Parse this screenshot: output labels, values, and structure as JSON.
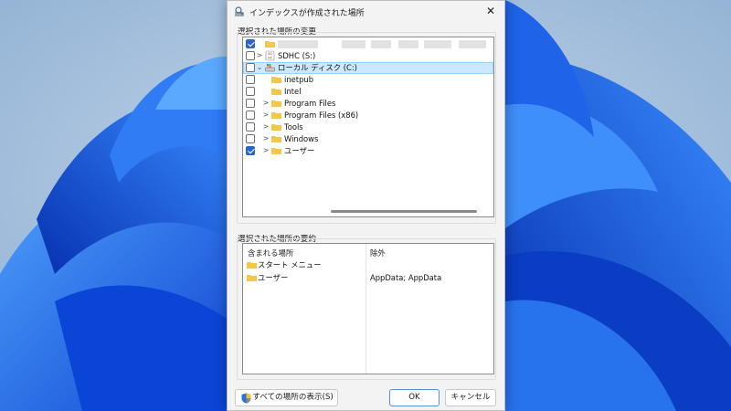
{
  "dialog": {
    "title": "インデックスが作成された場所",
    "close_glyph": "✕"
  },
  "locations_group": {
    "label": "選択された場所の変更",
    "tree": [
      {
        "label": "",
        "checked": true,
        "expander": "",
        "icon": "folder-icon",
        "blurred": true
      },
      {
        "label": "SDHC (S:)",
        "checked": false,
        "expander": ">",
        "icon": "sd-card-icon"
      },
      {
        "label": "ローカル ディスク (C:)",
        "checked": false,
        "expander": "v",
        "icon": "drive-icon",
        "selected": true
      },
      {
        "label": "inetpub",
        "checked": false,
        "expander": "",
        "icon": "folder-icon"
      },
      {
        "label": "Intel",
        "checked": false,
        "expander": "",
        "icon": "folder-icon"
      },
      {
        "label": "Program Files",
        "checked": false,
        "expander": ">",
        "icon": "folder-icon"
      },
      {
        "label": "Program Files (x86)",
        "checked": false,
        "expander": ">",
        "icon": "folder-icon"
      },
      {
        "label": "Tools",
        "checked": false,
        "expander": ">",
        "icon": "folder-icon"
      },
      {
        "label": "Windows",
        "checked": false,
        "expander": ">",
        "icon": "folder-icon"
      },
      {
        "label": "ユーザー",
        "checked": true,
        "expander": ">",
        "icon": "folder-icon"
      }
    ],
    "sd_icon_text": "SD\nHC"
  },
  "summary_group": {
    "label": "選択された場所の要約",
    "headers": {
      "included": "含まれる場所",
      "excluded": "除外"
    },
    "rows": [
      {
        "included": "スタート メニュー",
        "excluded": ""
      },
      {
        "included": "ユーザー",
        "excluded": "AppData; AppData"
      }
    ]
  },
  "buttons": {
    "show_all": "すべての場所の表示(S)",
    "ok": "OK",
    "cancel": "キャンセル"
  },
  "colors": {
    "accent": "#2a66c5",
    "selection": "#cce8ff",
    "folder": "#f4c74a"
  }
}
